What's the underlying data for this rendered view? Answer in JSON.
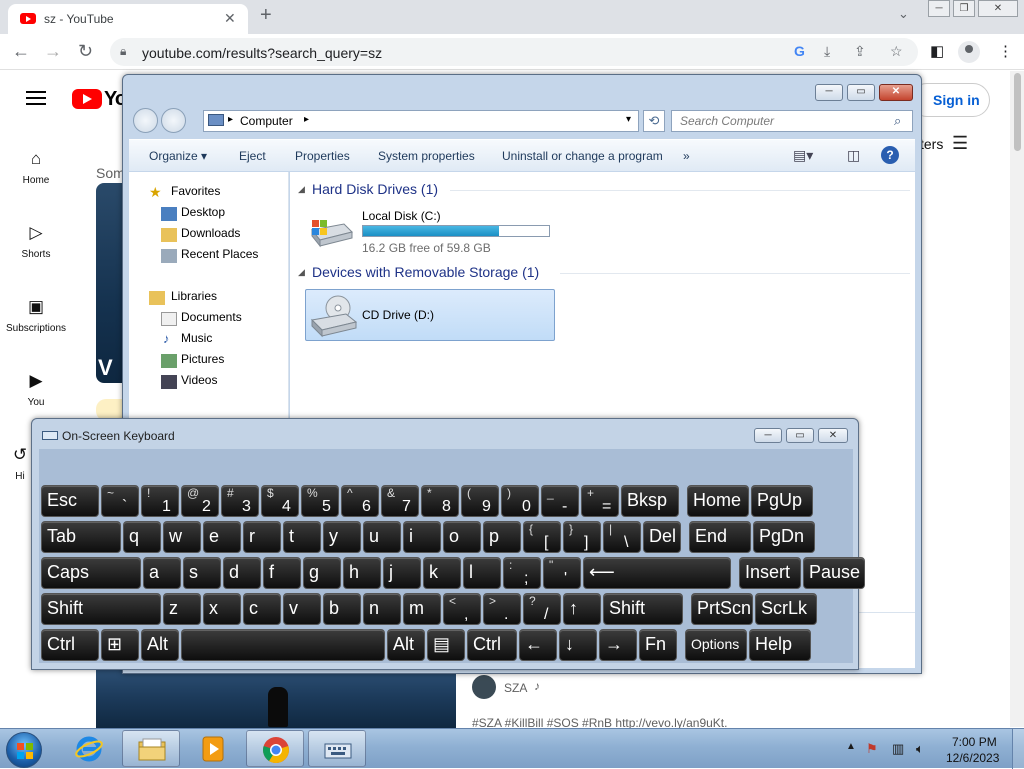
{
  "browser": {
    "tab_title": "sz - YouTube",
    "tab_close": "✕",
    "new_tab": "+",
    "url": "youtube.com/results?search_query=sz",
    "icons": [
      "back-icon",
      "forward-icon",
      "reload-icon",
      "lock-icon",
      "google-icon",
      "install-icon",
      "share-icon",
      "bookmark-star-icon",
      "side-panel-icon",
      "profile-icon",
      "menu-icon"
    ]
  },
  "youtube": {
    "logo_text": "Yo",
    "sidebar": [
      {
        "label": "Home",
        "icon": "home-icon"
      },
      {
        "label": "Shorts",
        "icon": "shorts-icon"
      },
      {
        "label": "Subscriptions",
        "icon": "subscriptions-icon"
      },
      {
        "label": "You",
        "icon": "you-icon"
      },
      {
        "label": "Hi",
        "icon": "history-icon"
      }
    ],
    "sign_in": "Sign in",
    "filters": "ters",
    "partial_text": "Som",
    "thumb_letter": "V",
    "channel": "SZA",
    "description": "#SZA #KillBill #SOS #RnB http://vevo.ly/an9uKt."
  },
  "explorer": {
    "address_location": "Computer",
    "search_placeholder": "Search Computer",
    "commands": [
      "Organize ▾",
      "Eject",
      "Properties",
      "System properties",
      "Uninstall or change a program",
      "»"
    ],
    "nav": {
      "favorites": "Favorites",
      "favorite_items": [
        "Desktop",
        "Downloads",
        "Recent Places"
      ],
      "libraries": "Libraries",
      "library_items": [
        "Documents",
        "Music",
        "Pictures",
        "Videos"
      ]
    },
    "groups": {
      "hard_disks": "Hard Disk Drives (1)",
      "removable": "Devices with Removable Storage (1)"
    },
    "local_disk": {
      "label": "Local Disk (C:)",
      "free_text": "16.2 GB free of 59.8 GB",
      "used_fraction": 0.73
    },
    "cd_drive": "CD Drive (D:)"
  },
  "osk": {
    "title": "On-Screen Keyboard",
    "rows": [
      [
        {
          "m": "Esc"
        },
        {
          "s": "~",
          "l": "`"
        },
        {
          "s": "!",
          "l": "1"
        },
        {
          "s": "@",
          "l": "2"
        },
        {
          "s": "#",
          "l": "3"
        },
        {
          "s": "$",
          "l": "4"
        },
        {
          "s": "%",
          "l": "5"
        },
        {
          "s": "^",
          "l": "6"
        },
        {
          "s": "&",
          "l": "7"
        },
        {
          "s": "*",
          "l": "8"
        },
        {
          "s": "(",
          "l": "9"
        },
        {
          "s": ")",
          "l": "0"
        },
        {
          "s": "_",
          "l": "-"
        },
        {
          "s": "+",
          "l": "="
        },
        {
          "m": "Bksp"
        },
        {
          "m": "Home"
        },
        {
          "m": "PgUp"
        }
      ],
      [
        {
          "m": "Tab"
        },
        {
          "m": "q"
        },
        {
          "m": "w"
        },
        {
          "m": "e"
        },
        {
          "m": "r"
        },
        {
          "m": "t"
        },
        {
          "m": "y"
        },
        {
          "m": "u"
        },
        {
          "m": "i"
        },
        {
          "m": "o"
        },
        {
          "m": "p"
        },
        {
          "s": "{",
          "l": "["
        },
        {
          "s": "}",
          "l": "]"
        },
        {
          "s": "|",
          "l": "\\"
        },
        {
          "m": "Del"
        },
        {
          "m": "End"
        },
        {
          "m": "PgDn"
        }
      ],
      [
        {
          "m": "Caps"
        },
        {
          "m": "a"
        },
        {
          "m": "s"
        },
        {
          "m": "d"
        },
        {
          "m": "f"
        },
        {
          "m": "g"
        },
        {
          "m": "h"
        },
        {
          "m": "j"
        },
        {
          "m": "k"
        },
        {
          "m": "l"
        },
        {
          "s": ":",
          "l": ";"
        },
        {
          "s": "\"",
          "l": "'"
        },
        {
          "m": "⟵"
        },
        {
          "m": "Insert"
        },
        {
          "m": "Pause"
        }
      ],
      [
        {
          "m": "Shift"
        },
        {
          "m": "z"
        },
        {
          "m": "x"
        },
        {
          "m": "c"
        },
        {
          "m": "v"
        },
        {
          "m": "b"
        },
        {
          "m": "n"
        },
        {
          "m": "m"
        },
        {
          "s": "<",
          "l": ","
        },
        {
          "s": ">",
          "l": "."
        },
        {
          "s": "?",
          "l": "/"
        },
        {
          "m": "↑"
        },
        {
          "m": "Shift"
        },
        {
          "m": "PrtScn"
        },
        {
          "m": "ScrLk"
        }
      ],
      [
        {
          "m": "Ctrl"
        },
        {
          "m": "⊞"
        },
        {
          "m": "Alt"
        },
        {
          "m": ""
        },
        {
          "m": "Alt"
        },
        {
          "m": "▤"
        },
        {
          "m": "Ctrl"
        },
        {
          "m": "←"
        },
        {
          "m": "↓"
        },
        {
          "m": "→"
        },
        {
          "m": "Fn"
        },
        {
          "m": "Options"
        },
        {
          "m": "Help"
        }
      ]
    ]
  },
  "taskbar": {
    "time": "7:00 PM",
    "date": "12/6/2023",
    "tray": [
      "▲",
      "flag-icon",
      "network-icon",
      "volume-icon"
    ]
  }
}
